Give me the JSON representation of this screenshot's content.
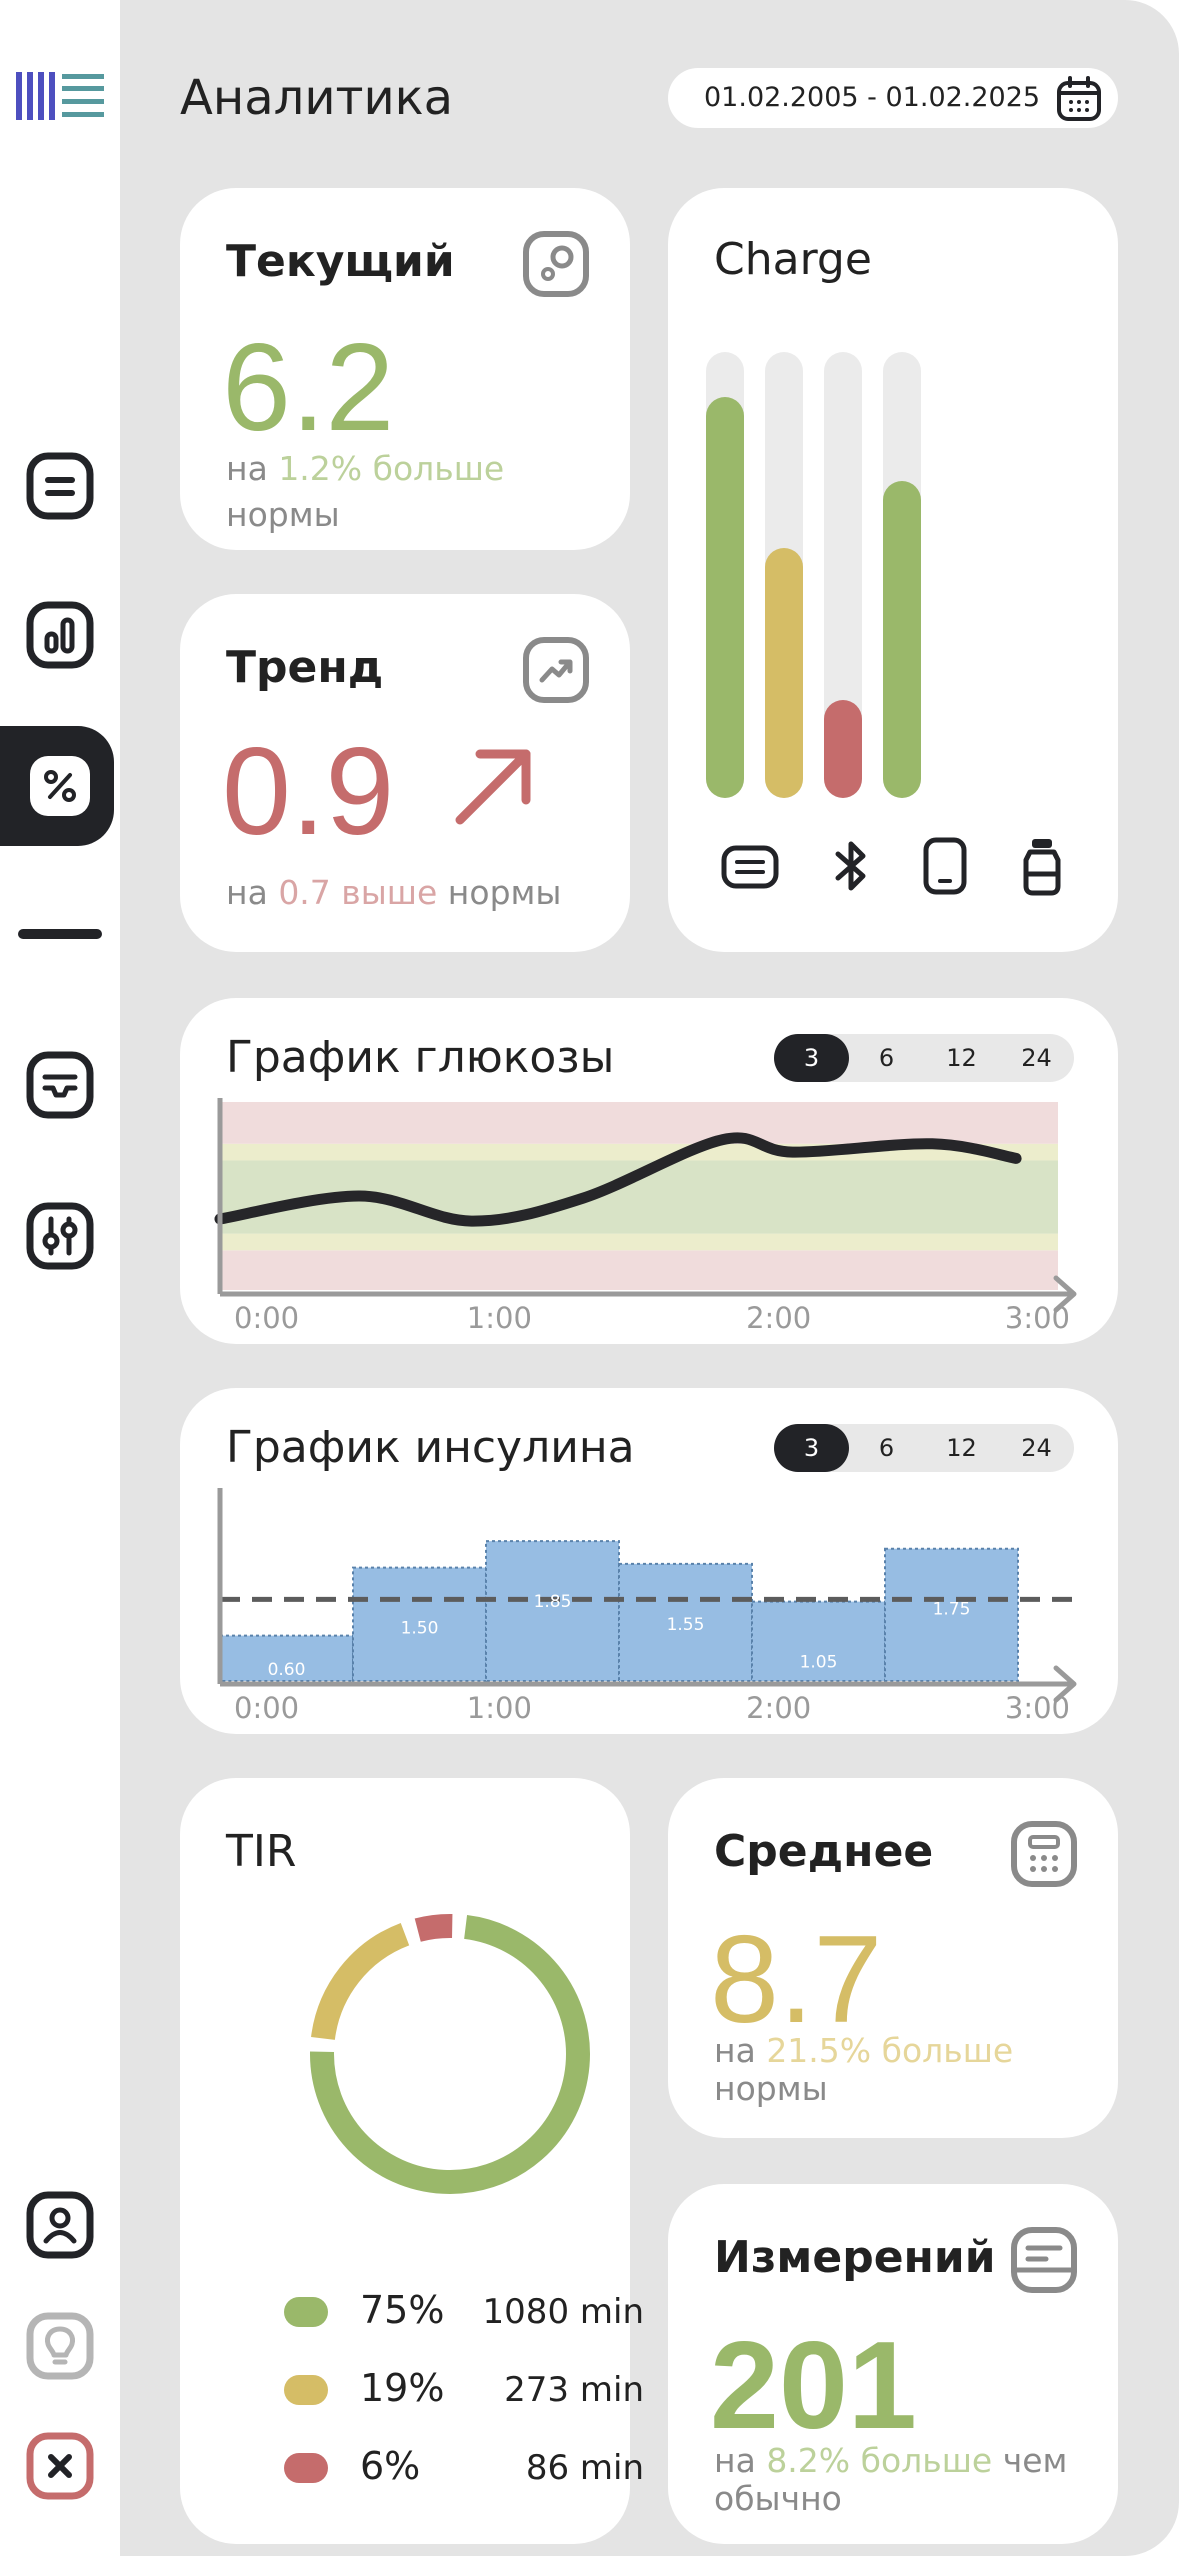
{
  "colors": {
    "green": "#9ab86a",
    "yellow": "#d5bd66",
    "red": "#c56c6c",
    "dark": "#222327",
    "bar_blue": "#97bde3"
  },
  "sidebar": {
    "logo_icon": "bars-logo-icon",
    "items": [
      {
        "icon": "notes-icon"
      },
      {
        "icon": "bar-chart-icon"
      },
      {
        "icon": "percent-icon",
        "active": true
      },
      {
        "icon": "inbox-icon"
      },
      {
        "icon": "sliders-icon"
      },
      {
        "icon": "user-icon"
      },
      {
        "icon": "lightbulb-icon"
      },
      {
        "icon": "close-icon"
      }
    ]
  },
  "header": {
    "title": "Аналитика",
    "date_range": "01.02.2005 - 01.02.2025",
    "calendar_icon": "calendar-icon"
  },
  "current": {
    "title": "Текущий",
    "value": "6.2",
    "prefix": "на",
    "highlight": "1.2% больше",
    "suffix": "нормы",
    "icon": "sensor-icon"
  },
  "trend": {
    "title": "Тренд",
    "value": "0.9",
    "prefix": "на",
    "highlight": "0.7 выше",
    "suffix": "нормы",
    "icon": "trend-up-icon",
    "arrow_icon": "arrow-up-right-icon"
  },
  "charge": {
    "title": "Charge",
    "levels": [
      0.9,
      0.56,
      0.22,
      0.71
    ],
    "devices": [
      "keyboard-icon",
      "bluetooth-icon",
      "phone-icon",
      "insulin-vial-icon"
    ]
  },
  "glucose": {
    "title": "График глюкозы",
    "ranges": [
      "3",
      "6",
      "12",
      "24"
    ],
    "active_range": "3"
  },
  "insulin": {
    "title": "График инсулина",
    "ranges": [
      "3",
      "6",
      "12",
      "24"
    ],
    "active_range": "3"
  },
  "tir": {
    "title": "TIR",
    "rows": [
      {
        "pct": "75%",
        "min": "1080 min"
      },
      {
        "pct": "19%",
        "min": "273 min"
      },
      {
        "pct": "6%",
        "min": "86 min"
      }
    ]
  },
  "average": {
    "title": "Среднее",
    "value": "8.7",
    "prefix": "на",
    "highlight": "21.5% больше",
    "suffix": "нормы",
    "icon": "calculator-icon"
  },
  "measurements": {
    "title": "Измерений",
    "value": "201",
    "prefix": "на",
    "highlight": "8.2% больше",
    "suffix1": "чем",
    "suffix2": "обычно",
    "icon": "notepad-icon"
  },
  "chart_data": [
    {
      "type": "line",
      "title": "График глюкозы",
      "x_ticks": [
        "0:00",
        "1:00",
        "2:00",
        "3:00"
      ],
      "x": [
        0,
        0.5,
        0.9,
        1.3,
        1.8,
        2.05,
        2.55,
        2.85
      ],
      "y": [
        5.4,
        6.5,
        5.3,
        6.4,
        9.2,
        8.6,
        9.0,
        8.3
      ],
      "ylim": [
        2,
        11
      ],
      "bands": [
        {
          "from": 2,
          "to": 3.9,
          "color": "#f0dcdc"
        },
        {
          "from": 3.9,
          "to": 4.7,
          "color": "#ecedcc"
        },
        {
          "from": 4.7,
          "to": 8.2,
          "color": "#d8e3c6"
        },
        {
          "from": 8.2,
          "to": 9,
          "color": "#ecedcc"
        },
        {
          "from": 9,
          "to": 11,
          "color": "#f0dcdc"
        }
      ]
    },
    {
      "type": "bar",
      "title": "График инсулина",
      "x_ticks": [
        "0:00",
        "1:00",
        "2:00",
        "3:00"
      ],
      "categories": [
        "0:00-0:30",
        "0:30-1:00",
        "1:00-1:30",
        "1:30-2:00",
        "2:00-2:30",
        "2:30-3:00"
      ],
      "values": [
        0.6,
        1.5,
        1.85,
        1.55,
        1.05,
        1.75
      ],
      "labels": [
        "0.60",
        "1.50",
        "1.85",
        "1.55",
        "1.05",
        "1.75"
      ],
      "reference_line": 1.08,
      "ylim": [
        0,
        2.5
      ]
    },
    {
      "type": "pie",
      "title": "TIR",
      "values": [
        75,
        19,
        6
      ],
      "colors": [
        "#9ab86a",
        "#d5bd66",
        "#c56c6c"
      ]
    }
  ]
}
